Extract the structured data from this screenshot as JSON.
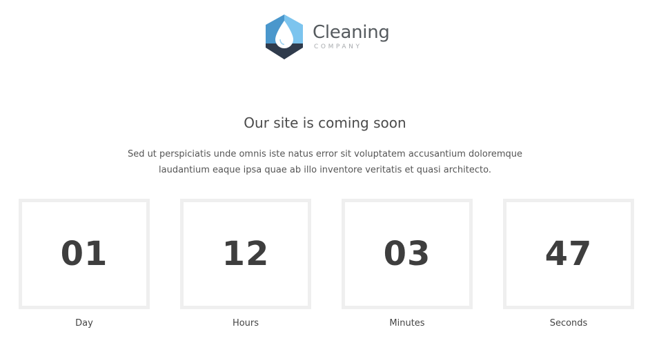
{
  "brand": {
    "name": "Cleaning",
    "tagline": "COMPANY",
    "colors": {
      "light_blue": "#7cc4ee",
      "mid_blue": "#4a97cc",
      "dark_navy": "#2f3b4c",
      "drop": "#ffffff"
    },
    "logo_icon": "water-drop-hexagon-icon"
  },
  "hero": {
    "title": "Our site is coming soon",
    "description": "Sed ut perspiciatis unde omnis iste natus error sit voluptatem accusantium doloremque laudantium eaque ipsa quae ab illo inventore veritatis et quasi architecto."
  },
  "countdown": [
    {
      "value": "01",
      "label": "Day"
    },
    {
      "value": "12",
      "label": "Hours"
    },
    {
      "value": "03",
      "label": "Minutes"
    },
    {
      "value": "47",
      "label": "Seconds"
    }
  ]
}
